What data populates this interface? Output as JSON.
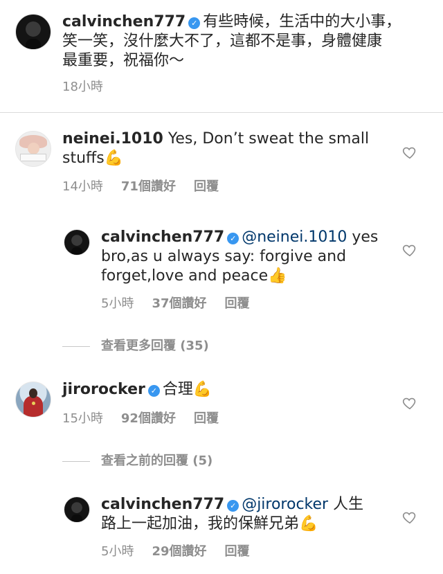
{
  "caption": {
    "username": "calvinchen777",
    "text_line1": "有些時候，生活中的大小事，",
    "text_line2": "笑一笑，沒什麼大不了，這都不是事，身體健康",
    "text_line3": "最重要，祝福你～",
    "time": "18小時"
  },
  "comments": [
    {
      "username": "neinei.1010",
      "text_line1": "Yes, Don’t sweat the small",
      "text_line2": "stuffs",
      "emoji": "💪",
      "time": "14小時",
      "likes": "71個讚好",
      "reply": "回覆",
      "replies": [
        {
          "username": "calvinchen777",
          "mention": "@neinei.1010",
          "text_line1": "yes",
          "text_line2": "bro,as u always say: forgive and",
          "text_line3": "forget,love and peace",
          "emoji": "👍",
          "time": "5小時",
          "likes": "37個讚好",
          "reply": "回覆"
        }
      ],
      "view_more": "查看更多回覆 (35)"
    },
    {
      "username": "jirorocker",
      "text_line1": "合理",
      "emoji": "💪",
      "time": "15小時",
      "likes": "92個讚好",
      "reply": "回覆",
      "view_previous": "查看之前的回覆 (5)",
      "replies": [
        {
          "username": "calvinchen777",
          "mention": "@jirorocker",
          "text_line1": "人生",
          "text_line2": "路上一起加油，我的保鮮兄弟",
          "emoji": "💪",
          "time": "5小時",
          "likes": "29個讚好",
          "reply": "回覆"
        }
      ]
    }
  ],
  "icons": {
    "verified": "verified-badge-icon",
    "like": "heart-outline-icon"
  },
  "colors": {
    "verified": "#3897f0",
    "meta": "#8e8e8e",
    "mention": "#00376b"
  }
}
